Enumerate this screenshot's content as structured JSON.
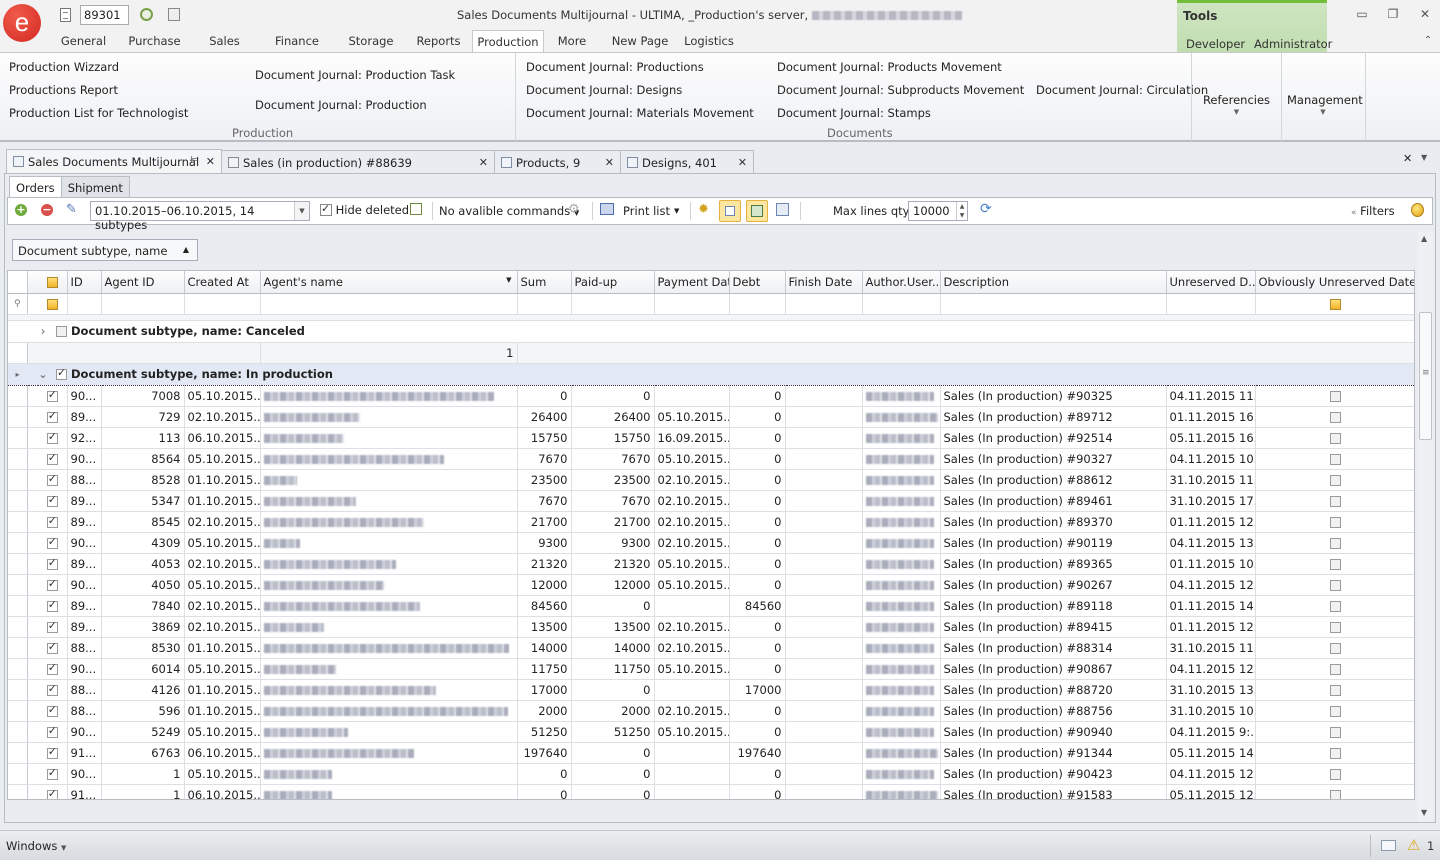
{
  "titlebar": {
    "doc_number": "89301",
    "title": "Sales Documents Multijournal - ULTIMA, _Production's server,",
    "menu_tabs": [
      {
        "label": "General",
        "active": false
      },
      {
        "label": "Purchase",
        "active": false
      },
      {
        "label": "Sales",
        "active": false
      },
      {
        "label": "Finance",
        "active": false
      },
      {
        "label": "Storage",
        "active": false
      },
      {
        "label": "Reports",
        "active": false
      },
      {
        "label": "Production",
        "active": true
      },
      {
        "label": "More",
        "active": false
      },
      {
        "label": "New Page",
        "active": false
      },
      {
        "label": "Logistics",
        "active": false
      }
    ],
    "tools": {
      "title": "Tools",
      "items": [
        "Developer",
        "Administrator"
      ],
      "accent": "#73bd3c"
    },
    "window_controls": {
      "minimize": "minimize-icon",
      "restore": "restore-icon",
      "close": "close-icon"
    }
  },
  "ribbon": {
    "production_group": {
      "label": "Production",
      "links": [
        "Production Wizzard",
        "Productions Report",
        "Production List for Technologist",
        "Document Journal: Production Task",
        "Document Journal: Production"
      ]
    },
    "documents_group": {
      "label": "Documents",
      "links": [
        "Document Journal: Productions",
        "Document Journal: Designs",
        "Document Journal: Materials Movement",
        "Document Journal: Products Movement",
        "Document Journal: Subproducts Movement",
        "Document Journal: Stamps",
        "Document Journal: Circulation"
      ]
    },
    "referencies": "Referencies",
    "management": "Management"
  },
  "doc_tabs": [
    {
      "label": "Sales Documents Multijournal",
      "active": true
    },
    {
      "label": "Sales (in production) #88639",
      "active": false
    },
    {
      "label": "Products, 9",
      "active": false
    },
    {
      "label": "Designs, 401",
      "active": false
    }
  ],
  "sub_tabs": [
    {
      "label": "Orders",
      "active": true
    },
    {
      "label": "Shipment",
      "active": false
    }
  ],
  "toolbar": {
    "date_filter": "01.10.2015–06.10.2015, 14 subtypes",
    "hide_deleted_label": "Hide deleted",
    "hide_deleted_checked": true,
    "commands_label": "No avalible commands",
    "print_label": "Print list",
    "max_lines_label": "Max lines qty:",
    "max_lines_value": "10000",
    "filters_label": "Filters"
  },
  "grouping": {
    "tag": "Document subtype, name"
  },
  "grid": {
    "columns": [
      "ID",
      "Agent ID",
      "Created At",
      "Agent's name",
      "Sum",
      "Paid-up",
      "Payment Date",
      "Debt",
      "Finish Date",
      "Author.User...",
      "Description",
      "Unreserved D...",
      "Obviously Unreserved Date"
    ],
    "groups": [
      {
        "label": "Document subtype, name: Canceled",
        "expanded": false,
        "checked": false,
        "count": "1"
      },
      {
        "label": "Document subtype, name: In production",
        "expanded": true,
        "checked": true
      }
    ],
    "rows": [
      {
        "id": "90...",
        "agent_id": "7008",
        "created": "05.10.2015...",
        "name_w": 230,
        "sum": "0",
        "paid": "0",
        "pay_date": "",
        "debt": "0",
        "author_w": 68,
        "desc": "Sales (In production) #90325",
        "unres": "04.11.2015 11..."
      },
      {
        "id": "89...",
        "agent_id": "729",
        "created": "02.10.2015...",
        "name_w": 96,
        "sum": "26400",
        "paid": "26400",
        "pay_date": "05.10.2015...",
        "debt": "0",
        "author_w": 72,
        "desc": "Sales (In production) #89712",
        "unres": "01.11.2015 16..."
      },
      {
        "id": "92...",
        "agent_id": "113",
        "created": "06.10.2015...",
        "name_w": 80,
        "sum": "15750",
        "paid": "15750",
        "pay_date": "16.09.2015...",
        "debt": "0",
        "author_w": 68,
        "desc": "Sales (In production) #92514",
        "unres": "05.11.2015 16..."
      },
      {
        "id": "90...",
        "agent_id": "8564",
        "created": "05.10.2015...",
        "name_w": 180,
        "sum": "7670",
        "paid": "7670",
        "pay_date": "05.10.2015...",
        "debt": "0",
        "author_w": 68,
        "desc": "Sales (In production) #90327",
        "unres": "04.11.2015 10..."
      },
      {
        "id": "88...",
        "agent_id": "8528",
        "created": "01.10.2015...",
        "name_w": 33,
        "sum": "23500",
        "paid": "23500",
        "pay_date": "02.10.2015...",
        "debt": "0",
        "author_w": 68,
        "desc": "Sales (In production) #88612",
        "unres": "31.10.2015 11..."
      },
      {
        "id": "89...",
        "agent_id": "5347",
        "created": "01.10.2015...",
        "name_w": 92,
        "sum": "7670",
        "paid": "7670",
        "pay_date": "02.10.2015...",
        "debt": "0",
        "author_w": 68,
        "desc": "Sales (In production) #89461",
        "unres": "31.10.2015 17..."
      },
      {
        "id": "89...",
        "agent_id": "8545",
        "created": "02.10.2015...",
        "name_w": 160,
        "sum": "21700",
        "paid": "21700",
        "pay_date": "02.10.2015...",
        "debt": "0",
        "author_w": 68,
        "desc": "Sales (In production) #89370",
        "unres": "01.11.2015 12..."
      },
      {
        "id": "90...",
        "agent_id": "4309",
        "created": "05.10.2015...",
        "name_w": 36,
        "sum": "9300",
        "paid": "9300",
        "pay_date": "02.10.2015...",
        "debt": "0",
        "author_w": 68,
        "desc": "Sales (In production) #90119",
        "unres": "04.11.2015 13..."
      },
      {
        "id": "89...",
        "agent_id": "4053",
        "created": "02.10.2015...",
        "name_w": 132,
        "sum": "21320",
        "paid": "21320",
        "pay_date": "05.10.2015...",
        "debt": "0",
        "author_w": 68,
        "desc": "Sales (In production) #89365",
        "unres": "01.11.2015 10..."
      },
      {
        "id": "90...",
        "agent_id": "4050",
        "created": "05.10.2015...",
        "name_w": 120,
        "sum": "12000",
        "paid": "12000",
        "pay_date": "05.10.2015...",
        "debt": "0",
        "author_w": 68,
        "desc": "Sales (In production) #90267",
        "unres": "04.11.2015 12..."
      },
      {
        "id": "89...",
        "agent_id": "7840",
        "created": "02.10.2015...",
        "name_w": 156,
        "sum": "84560",
        "paid": "0",
        "pay_date": "",
        "debt": "84560",
        "author_w": 68,
        "desc": "Sales (In production) #89118",
        "unres": "01.11.2015 14..."
      },
      {
        "id": "89...",
        "agent_id": "3869",
        "created": "02.10.2015...",
        "name_w": 60,
        "sum": "13500",
        "paid": "13500",
        "pay_date": "02.10.2015...",
        "debt": "0",
        "author_w": 68,
        "desc": "Sales (In production) #89415",
        "unres": "01.11.2015 12..."
      },
      {
        "id": "88...",
        "agent_id": "8530",
        "created": "01.10.2015...",
        "name_w": 245,
        "sum": "14000",
        "paid": "14000",
        "pay_date": "02.10.2015...",
        "debt": "0",
        "author_w": 68,
        "desc": "Sales (In production) #88314",
        "unres": "31.10.2015 11..."
      },
      {
        "id": "90...",
        "agent_id": "6014",
        "created": "05.10.2015...",
        "name_w": 72,
        "sum": "11750",
        "paid": "11750",
        "pay_date": "05.10.2015...",
        "debt": "0",
        "author_w": 68,
        "desc": "Sales (In production) #90867",
        "unres": "04.11.2015 12..."
      },
      {
        "id": "88...",
        "agent_id": "4126",
        "created": "01.10.2015...",
        "name_w": 172,
        "sum": "17000",
        "paid": "0",
        "pay_date": "",
        "debt": "17000",
        "author_w": 68,
        "desc": "Sales (In production) #88720",
        "unres": "31.10.2015 13..."
      },
      {
        "id": "88...",
        "agent_id": "596",
        "created": "01.10.2015...",
        "name_w": 244,
        "sum": "2000",
        "paid": "2000",
        "pay_date": "02.10.2015...",
        "debt": "0",
        "author_w": 68,
        "desc": "Sales (In production) #88756",
        "unres": "31.10.2015 10..."
      },
      {
        "id": "90...",
        "agent_id": "5249",
        "created": "05.10.2015...",
        "name_w": 84,
        "sum": "51250",
        "paid": "51250",
        "pay_date": "05.10.2015...",
        "debt": "0",
        "author_w": 68,
        "desc": "Sales (In production) #90940",
        "unres": "04.11.2015 9:..."
      },
      {
        "id": "91...",
        "agent_id": "6763",
        "created": "06.10.2015...",
        "name_w": 150,
        "sum": "197640",
        "paid": "0",
        "pay_date": "",
        "debt": "197640",
        "author_w": 72,
        "desc": "Sales (In production) #91344",
        "unres": "05.11.2015 14..."
      },
      {
        "id": "90...",
        "agent_id": "1",
        "created": "05.10.2015...",
        "name_w": 68,
        "sum": "0",
        "paid": "0",
        "pay_date": "",
        "debt": "0",
        "author_w": 68,
        "desc": "Sales (In production) #90423",
        "unres": "04.11.2015 12..."
      },
      {
        "id": "91...",
        "agent_id": "1",
        "created": "06.10.2015...",
        "name_w": 68,
        "sum": "0",
        "paid": "0",
        "pay_date": "",
        "debt": "0",
        "author_w": 72,
        "desc": "Sales (In production) #91583",
        "unres": "05.11.2015 12..."
      }
    ]
  },
  "statusbar": {
    "windows_label": "Windows",
    "warnings_count": "1"
  }
}
